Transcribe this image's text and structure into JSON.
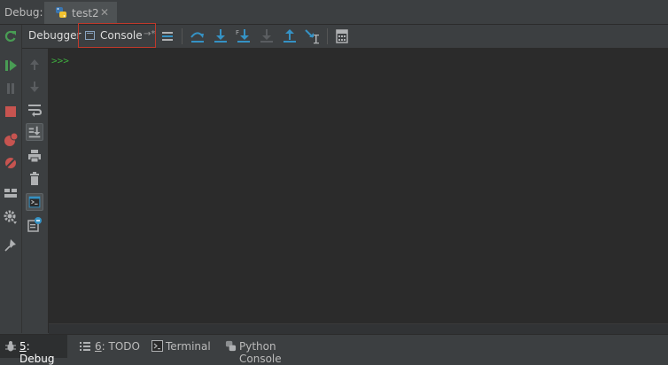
{
  "window": {
    "debug_label": "Debug:",
    "run_tab_title": "test2"
  },
  "toolbar": {
    "tabs": [
      {
        "label": "Debugger"
      },
      {
        "label": "Console",
        "selected": true
      }
    ],
    "pin_glyph": "→*"
  },
  "console": {
    "prompt": ">>>"
  },
  "left_actions": [
    "rerun-icon",
    "resume-icon",
    "pause-icon",
    "stop-icon",
    "view-breakpoints-icon",
    "mute-breakpoints-icon",
    "restore-layout-icon",
    "settings-icon",
    "pin-icon"
  ],
  "console_actions": [
    "up-arrow-icon",
    "down-arrow-icon",
    "soft-wrap-icon",
    "scroll-to-end-icon",
    "print-icon",
    "clear-all-icon",
    "show-console-icon",
    "new-console-icon"
  ],
  "debug_actions": [
    "show-execution-point-icon",
    "step-over-icon",
    "step-into-icon",
    "step-into-my-code-icon",
    "force-step-into-icon",
    "step-out-icon",
    "run-to-cursor-icon",
    "evaluate-expression-icon"
  ],
  "bottom_tabs": [
    {
      "number": "5",
      "label": ": Debug",
      "active": true
    },
    {
      "number": "6",
      "label": ": TODO"
    },
    {
      "label": "Terminal"
    },
    {
      "label": "Python Console"
    }
  ],
  "colors": {
    "accent": "#3592c4",
    "rerun": "#499c54",
    "stop": "#c75450",
    "selection_border": "#c0392b",
    "prompt": "#3eaa3e"
  }
}
